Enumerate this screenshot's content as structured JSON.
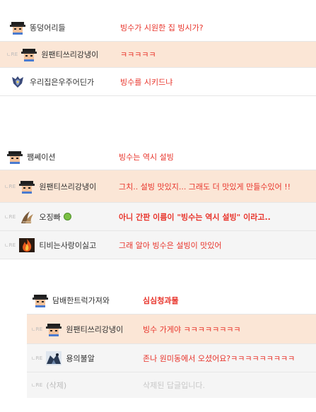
{
  "threads": [
    {
      "comments": [
        {
          "nickname": "똥덩어리들",
          "text": "빙수가 시원한 집 빙시가?",
          "avatar_icon": "pixel-character-avatar-icon",
          "reply": false,
          "highlight": false
        },
        {
          "nickname": "원팬티쓰리강냉이",
          "text": "ㅋㅋㅋㅋㅋ",
          "avatar_icon": "pixel-character-avatar-icon",
          "reply": true,
          "highlight": true
        },
        {
          "nickname": "우리집은우주어딘가",
          "text": "빙수를 시키드냐",
          "avatar_icon": "armored-warrior-avatar-icon",
          "reply": false,
          "highlight": false
        }
      ]
    },
    {
      "comments": [
        {
          "nickname": "쨈쎄이션",
          "text": "빙수는 역시 설빙",
          "avatar_icon": "pixel-character-avatar-icon",
          "reply": false,
          "highlight": false
        },
        {
          "nickname": "원팬티쓰리강냉이",
          "text": "그치.. 설빙 맛있지... 그래도 더 맛있게 만들수있어 !!",
          "avatar_icon": "pixel-character-avatar-icon",
          "reply": true,
          "highlight": true
        },
        {
          "nickname": "오징빠",
          "text": "아니 간판 이름이 \"빙수는 역시 설빙\" 이라고..",
          "avatar_icon": "claw-avatar-icon",
          "reply": true,
          "highlight": false,
          "bold": true
        },
        {
          "nickname": "티비는사랑이싫고",
          "text": "그래 알아 빙수은 설빙이 맛있어",
          "avatar_icon": "fire-avatar-icon",
          "reply": true,
          "highlight": false
        }
      ]
    },
    {
      "comments": [
        {
          "nickname": "담배한트럭가져와",
          "text": "심심청과물",
          "avatar_icon": "pixel-character-avatar-icon",
          "reply": false,
          "highlight": false,
          "bold": true
        },
        {
          "nickname": "원팬티쓰리강냉이",
          "text": "빙수 가게야 ㅋㅋㅋㅋㅋㅋㅋㅋ",
          "avatar_icon": "pixel-character-avatar-icon",
          "reply": true,
          "highlight": true
        },
        {
          "nickname": "용의불알",
          "text": "존나 원미동에서 오셨어요?ㅋㅋㅋㅋㅋㅋㅋㅋㅋ",
          "avatar_icon": "dragon-rider-avatar-icon",
          "reply": true,
          "highlight": false
        },
        {
          "nickname": "(삭제)",
          "text": "삭제된 답글입니다.",
          "avatar_icon": "",
          "reply": true,
          "highlight": false,
          "deleted": true
        }
      ]
    }
  ],
  "reply_marker": "ㄴRE"
}
